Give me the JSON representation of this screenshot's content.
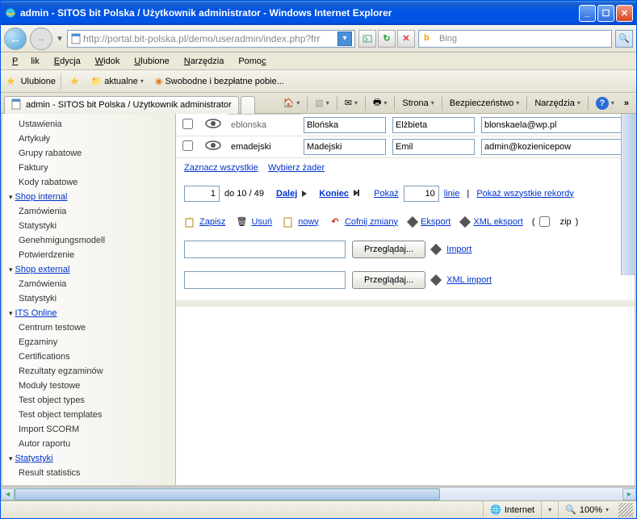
{
  "window": {
    "title": "admin - SITOS bit Polska / Użytkownik administrator - Windows Internet Explorer"
  },
  "nav": {
    "url": "http://portal.bit-polska.pl/demo/useradmin/index.php?frr",
    "search_placeholder": "Bing"
  },
  "menubar": {
    "file": "Plik",
    "edit": "Edycja",
    "view": "Widok",
    "favorites": "Ulubione",
    "tools": "Narzędzia",
    "help": "Pomoc"
  },
  "favbar": {
    "favorites": "Ulubione",
    "aktualne": "aktualne",
    "swobodne": "Swobodne i bezpłatne pobie..."
  },
  "tab": {
    "title": "admin - SITOS bit Polska / Użytkownik administrator"
  },
  "commandbar": {
    "strona": "Strona",
    "bezpieczenstwo": "Bezpieczeństwo",
    "narzedzia": "Narzędzia"
  },
  "sidebar": {
    "items": [
      {
        "label": "Ustawienia",
        "type": "item"
      },
      {
        "label": "Artykuły",
        "type": "item"
      },
      {
        "label": "Grupy rabatowe",
        "type": "item"
      },
      {
        "label": "Faktury",
        "type": "item"
      },
      {
        "label": "Kody rabatowe",
        "type": "item"
      },
      {
        "label": "Shop internal",
        "type": "header"
      },
      {
        "label": "Zamówienia",
        "type": "item"
      },
      {
        "label": "Statystyki",
        "type": "item"
      },
      {
        "label": "Genehmigungsmodell",
        "type": "item"
      },
      {
        "label": "Potwierdzenie",
        "type": "item"
      },
      {
        "label": "Shop external",
        "type": "header"
      },
      {
        "label": "Zamówienia",
        "type": "item"
      },
      {
        "label": "Statystyki",
        "type": "item"
      },
      {
        "label": "ITS Online",
        "type": "header"
      },
      {
        "label": "Centrum testowe",
        "type": "item"
      },
      {
        "label": "Egzaminy",
        "type": "item"
      },
      {
        "label": "Certifications",
        "type": "item"
      },
      {
        "label": "Rezultaty egzaminów",
        "type": "item"
      },
      {
        "label": "Moduły testowe",
        "type": "item"
      },
      {
        "label": "Test object types",
        "type": "item"
      },
      {
        "label": "Test object templates",
        "type": "item"
      },
      {
        "label": "Import SCORM",
        "type": "item"
      },
      {
        "label": "Autor raportu",
        "type": "item"
      },
      {
        "label": "Statystyki",
        "type": "header"
      },
      {
        "label": "Result statistics",
        "type": "item"
      }
    ]
  },
  "table": {
    "rows": [
      {
        "username": "eblonska",
        "lastname": "Blońska",
        "firstname": "Elżbieta",
        "email": "blonskaela@wp.pl"
      },
      {
        "username": "emadejski",
        "lastname": "Madejski",
        "firstname": "Emil",
        "email": "admin@kozienicepow"
      }
    ]
  },
  "links": {
    "select_all": "Zaznacz wszystkie",
    "select_none": "Wybierz żader"
  },
  "pagination": {
    "page_input": "1",
    "do_text": "do 10 / 49",
    "dalej": "Dalej",
    "koniec": "Koniec",
    "pokaz": "Pokaż",
    "limit_input": "10",
    "linie": "linie",
    "show_all": "Pokaż wszystkie rekordy"
  },
  "actions": {
    "zapisz": "Zapisz",
    "usun": "Usuń",
    "nowy": "nowy",
    "cofnij": "Cofnij zmiany",
    "eksport": "Eksport",
    "xml_eksport": "XML eksport",
    "zip": "zip"
  },
  "import": {
    "browse": "Przeglądaj...",
    "import": "Import",
    "xml_import": "XML import"
  },
  "statusbar": {
    "internet": "Internet",
    "zoom": "100%"
  }
}
